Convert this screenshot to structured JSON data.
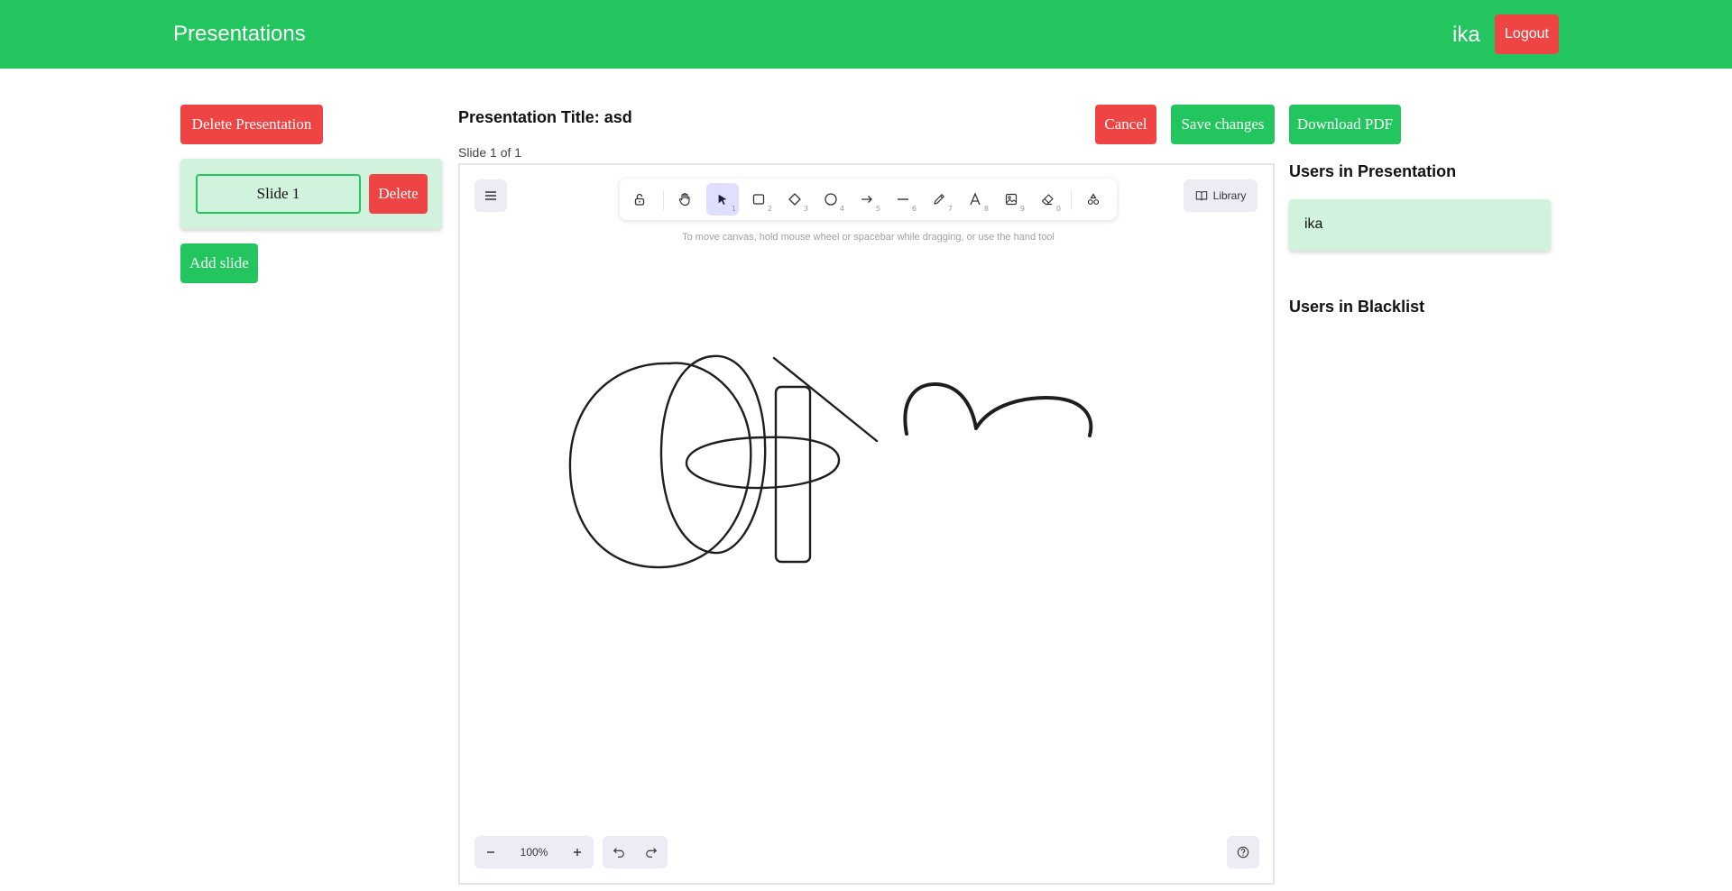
{
  "header": {
    "app_title": "Presentations",
    "username": "ika",
    "logout_label": "Logout",
    "bg_color": "#22c55e"
  },
  "sidebar": {
    "delete_presentation_label": "Delete Presentation",
    "slides": [
      {
        "label": "Slide 1",
        "delete_label": "Delete"
      }
    ],
    "add_slide_label": "Add slide"
  },
  "main": {
    "title": "Presentation Title: asd",
    "slide_counter": "Slide 1 of 1",
    "cancel_label": "Cancel",
    "save_label": "Save changes",
    "download_label": "Download PDF"
  },
  "editor": {
    "hint": "To move canvas, hold mouse wheel or spacebar while dragging, or use the hand tool",
    "library_label": "Library",
    "zoom": "100%",
    "active_tool": "selection",
    "tools": [
      {
        "name": "lock-icon",
        "key": ""
      },
      {
        "name": "hand-icon",
        "key": ""
      },
      {
        "name": "pointer-icon",
        "key": "1"
      },
      {
        "name": "rectangle-icon",
        "key": "2"
      },
      {
        "name": "diamond-icon",
        "key": "3"
      },
      {
        "name": "ellipse-icon",
        "key": "4"
      },
      {
        "name": "arrow-icon",
        "key": "5"
      },
      {
        "name": "line-icon",
        "key": "6"
      },
      {
        "name": "pencil-icon",
        "key": "7"
      },
      {
        "name": "text-icon",
        "key": "8"
      },
      {
        "name": "image-icon",
        "key": "9"
      },
      {
        "name": "eraser-icon",
        "key": "0"
      },
      {
        "name": "shapes-icon",
        "key": ""
      }
    ]
  },
  "users_panel": {
    "in_presentation_title": "Users in Presentation",
    "users": [
      "ika"
    ],
    "blacklist_title": "Users in Blacklist"
  },
  "colors": {
    "accent_green": "#22c55e",
    "danger_red": "#ef4444",
    "light_green": "#d1f2dd",
    "tool_active": "#e0dfff"
  }
}
